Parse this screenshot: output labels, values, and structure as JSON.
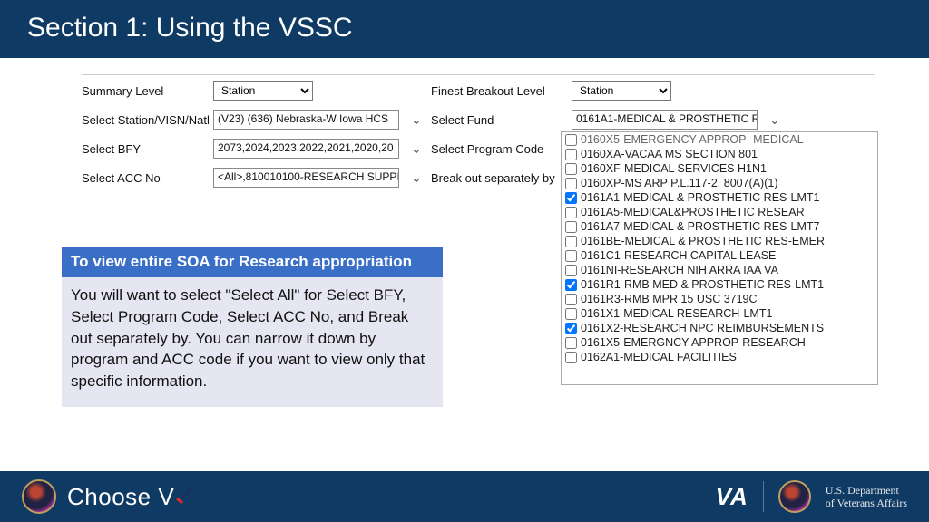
{
  "header": {
    "title": "Section 1: Using the VSSC"
  },
  "filters": {
    "summary_level": {
      "label": "Summary Level",
      "value": "Station"
    },
    "select_station": {
      "label": "Select Station/VISN/Natl",
      "value": "(V23) (636) Nebraska-W Iowa HCS"
    },
    "select_bfy": {
      "label": "Select BFY",
      "value": "2073,2024,2023,2022,2021,2020,20"
    },
    "select_acc": {
      "label": "Select ACC No",
      "value": "<All>,810010100-RESEARCH SUPPI"
    },
    "finest_breakout": {
      "label": "Finest Breakout Level",
      "value": "Station"
    },
    "select_fund": {
      "label": "Select Fund",
      "value": "0161A1-MEDICAL & PROSTHETIC R"
    },
    "select_program_code": {
      "label": "Select Program Code"
    },
    "breakout_by": {
      "label": "Break out separately by"
    }
  },
  "fund_list": [
    {
      "label": "0160X5-EMERGENCY APPROP- MEDICAL",
      "checked": false,
      "cut": true
    },
    {
      "label": "0160XA-VACAA MS  SECTION 801",
      "checked": false
    },
    {
      "label": "0160XF-MEDICAL SERVICES H1N1",
      "checked": false
    },
    {
      "label": "0160XP-MS ARP P.L.117-2, 8007(A)(1)",
      "checked": false
    },
    {
      "label": "0161A1-MEDICAL & PROSTHETIC RES-LMT1",
      "checked": true
    },
    {
      "label": "0161A5-MEDICAL&PROSTHETIC RESEAR",
      "checked": false
    },
    {
      "label": "0161A7-MEDICAL & PROSTHETIC RES-LMT7",
      "checked": false
    },
    {
      "label": "0161BE-MEDICAL & PROSTHETIC RES-EMER",
      "checked": false
    },
    {
      "label": "0161C1-RESEARCH CAPITAL LEASE",
      "checked": false
    },
    {
      "label": "0161NI-RESEARCH NIH ARRA IAA VA",
      "checked": false
    },
    {
      "label": "0161R1-RMB MED & PROSTHETIC RES-LMT1",
      "checked": true
    },
    {
      "label": "0161R3-RMB MPR 15 USC 3719C",
      "checked": false
    },
    {
      "label": "0161X1-MEDICAL RESEARCH-LMT1",
      "checked": false
    },
    {
      "label": "0161X2-RESEARCH NPC REIMBURSEMENTS",
      "checked": true
    },
    {
      "label": "0161X5-EMERGNCY APPROP-RESEARCH",
      "checked": false
    },
    {
      "label": "0162A1-MEDICAL FACILITIES",
      "checked": false
    }
  ],
  "callout": {
    "heading": "To view entire SOA for Research appropriation",
    "body": "You will want to select \"Select All\" for Select BFY, Select Program Code, Select ACC No, and Break out separately by. You can narrow it down by program and ACC code if you want to view only that specific information."
  },
  "footer": {
    "choose_a": "Choose",
    "choose_b": "V",
    "choose_c": "A",
    "va": "VA",
    "dept1": "U.S. Department",
    "dept2": "of Veterans Affairs"
  }
}
